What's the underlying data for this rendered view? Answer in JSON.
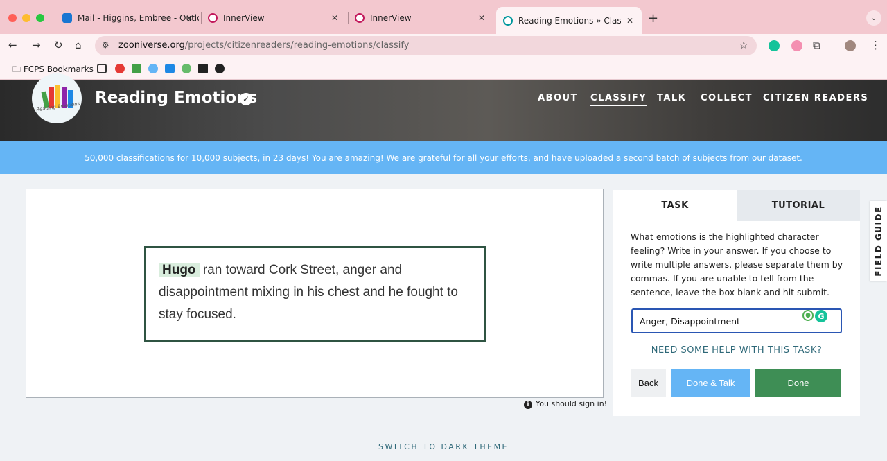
{
  "browser": {
    "tabs": [
      {
        "title": "Mail - Higgins, Embree - Outlo",
        "favicon_color": "#1976d2"
      },
      {
        "title": "InnerView",
        "favicon_color": "#ffffff"
      },
      {
        "title": "InnerView",
        "favicon_color": "#ffffff"
      },
      {
        "title": "Reading Emotions » Classify",
        "favicon_color": "#00979d"
      }
    ],
    "url_host": "zooniverse.org",
    "url_path": "/projects/citizenreaders/reading-emotions/classify",
    "bookmarks_folder": "FCPS Bookmarks"
  },
  "project": {
    "title": "Reading Emotions",
    "logo_text": "Reading Emotions",
    "nav": [
      "ABOUT",
      "CLASSIFY",
      "TALK",
      "COLLECT",
      "CITIZEN READERS"
    ]
  },
  "banner": "50,000 classifications for 10,000 subjects, in 23 days! You are amazing! We are grateful for all your efforts, and have uploaded a second batch of subjects from our dataset.",
  "subject": {
    "highlighted_name": "Hugo",
    "sentence_rest": " ran toward Cork Street, anger and disappointment mixing in his chest and he fought to stay focused."
  },
  "signin_notice": "You should sign in!",
  "panel": {
    "tab_task": "TASK",
    "tab_tutorial": "TUTORIAL",
    "question": "What emotions is the highlighted character feeling? Write in your answer. If you choose to write multiple answers, please separate them by commas. If you are unable to tell from the sentence, leave the box blank and hit submit.",
    "answer_value": "Anger, Disappointment",
    "help_link": "NEED SOME HELP WITH THIS TASK?",
    "back": "Back",
    "done_talk": "Done & Talk",
    "done": "Done"
  },
  "field_guide": "FIELD GUIDE",
  "dark_theme": "SWITCH TO DARK THEME",
  "colors": {
    "accent_blue": "#65b5f5",
    "done_green": "#3e8e55",
    "frame_green": "#2f5442",
    "link_teal": "#2e6878"
  }
}
